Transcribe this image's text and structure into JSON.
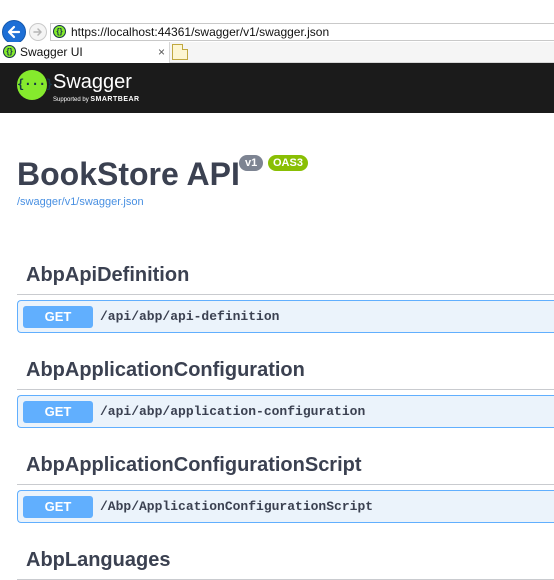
{
  "browser": {
    "url": "https://localhost:44361/swagger/v1/swagger.json",
    "tab_title": "Swagger UI",
    "tab_close": "×"
  },
  "topbar": {
    "logo_glyph": "{···}",
    "brand": "Swagger",
    "supported_by": "Supported by",
    "company": "SMARTBEAR"
  },
  "info": {
    "title": "BookStore API",
    "version_badge": "v1",
    "oas_badge": "OAS3",
    "spec_link": "/swagger/v1/swagger.json"
  },
  "colors": {
    "topbar_bg": "#1b1b1b",
    "swagger_green": "#85ea2d",
    "get_method": "#61affe",
    "get_bg": "#ebf3fb",
    "oas_badge": "#89bf04",
    "version_badge": "#7d8492"
  },
  "groups": [
    {
      "name": "AbpApiDefinition",
      "operations": [
        {
          "method": "GET",
          "path": "/api/abp/api-definition"
        }
      ]
    },
    {
      "name": "AbpApplicationConfiguration",
      "operations": [
        {
          "method": "GET",
          "path": "/api/abp/application-configuration"
        }
      ]
    },
    {
      "name": "AbpApplicationConfigurationScript",
      "operations": [
        {
          "method": "GET",
          "path": "/Abp/ApplicationConfigurationScript"
        }
      ]
    },
    {
      "name": "AbpLanguages",
      "operations": []
    }
  ]
}
